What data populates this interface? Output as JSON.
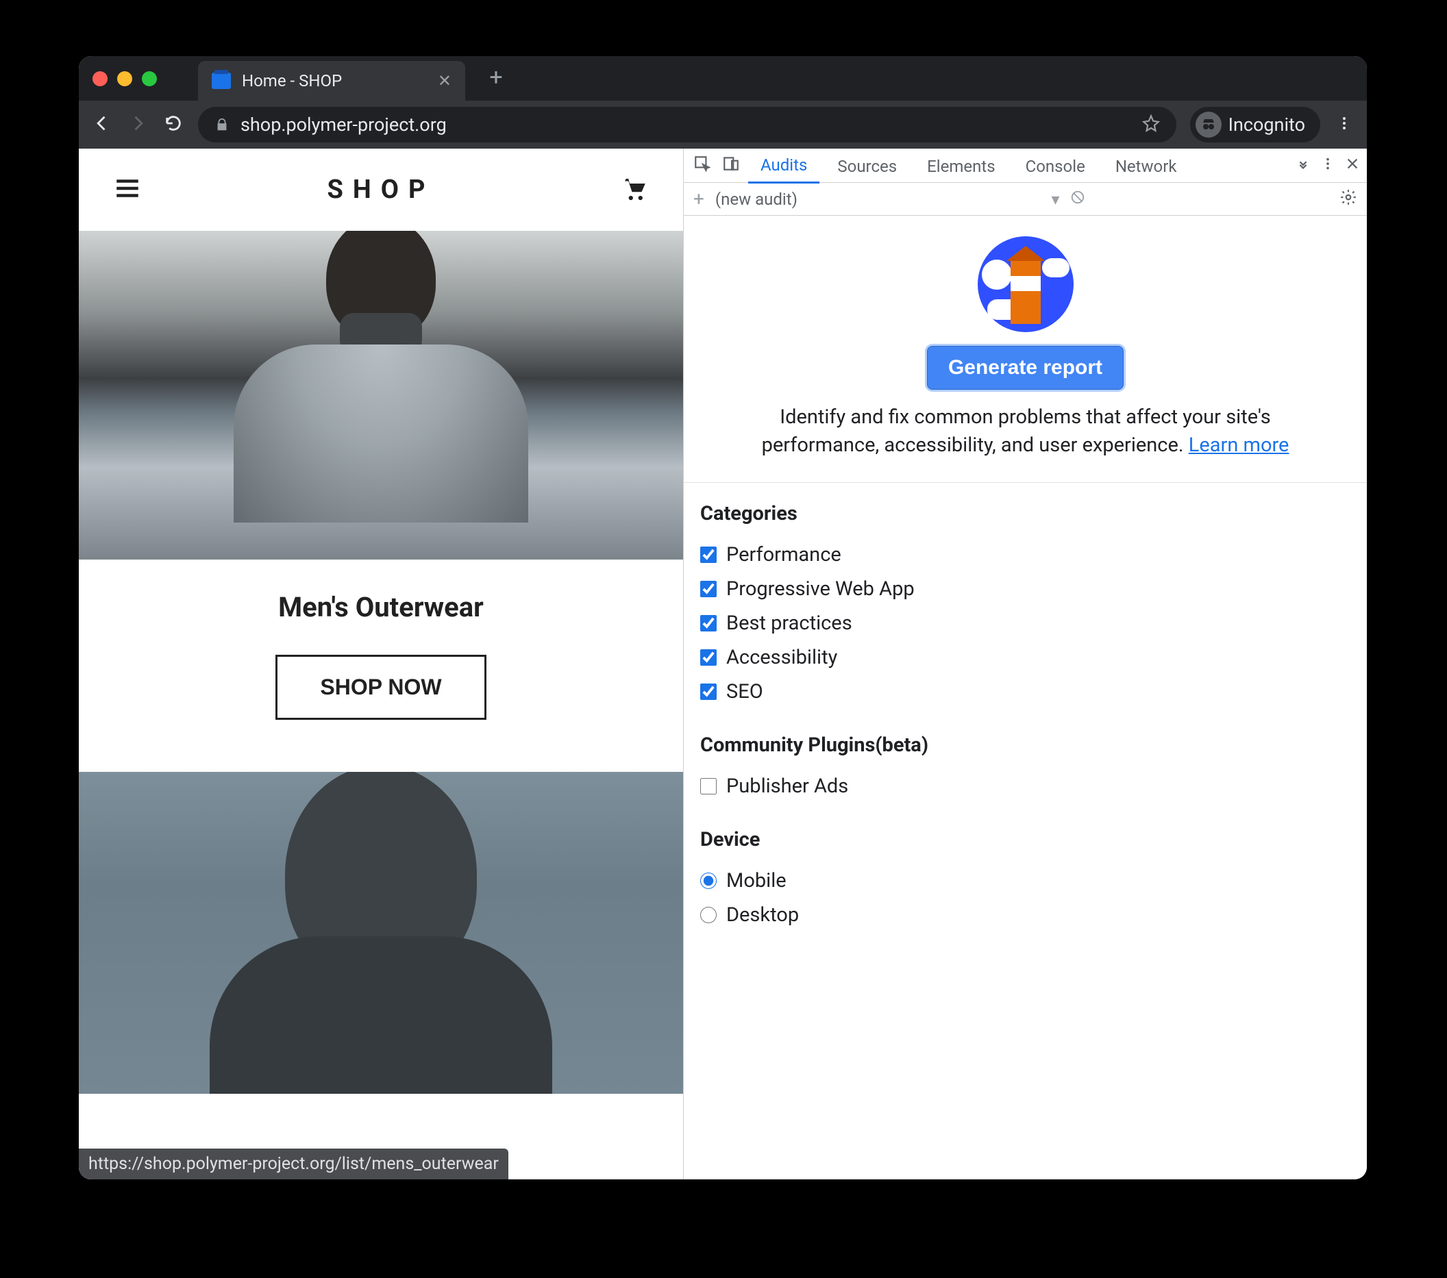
{
  "browser": {
    "tab_title": "Home - SHOP",
    "url": "shop.polymer-project.org",
    "mode_label": "Incognito",
    "status_url": "https://shop.polymer-project.org/list/mens_outerwear"
  },
  "page": {
    "logo": "SHOP",
    "category_title": "Men's Outerwear",
    "shop_now_label": "SHOP NOW"
  },
  "devtools": {
    "tabs": {
      "audits": "Audits",
      "sources": "Sources",
      "elements": "Elements",
      "console": "Console",
      "network": "Network"
    },
    "subbar": {
      "audit_name": "(new audit)"
    },
    "gear_label": "Settings",
    "audit": {
      "generate_label": "Generate report",
      "description": "Identify and fix common problems that affect your site's performance, accessibility, and user experience. ",
      "learn_more": "Learn more",
      "sections": {
        "categories": "Categories",
        "plugins": "Community Plugins(beta)",
        "device": "Device"
      },
      "categories": {
        "performance": "Performance",
        "pwa": "Progressive Web App",
        "best": "Best practices",
        "a11y": "Accessibility",
        "seo": "SEO"
      },
      "plugins": {
        "ads": "Publisher Ads"
      },
      "device": {
        "mobile": "Mobile",
        "desktop": "Desktop"
      }
    }
  }
}
